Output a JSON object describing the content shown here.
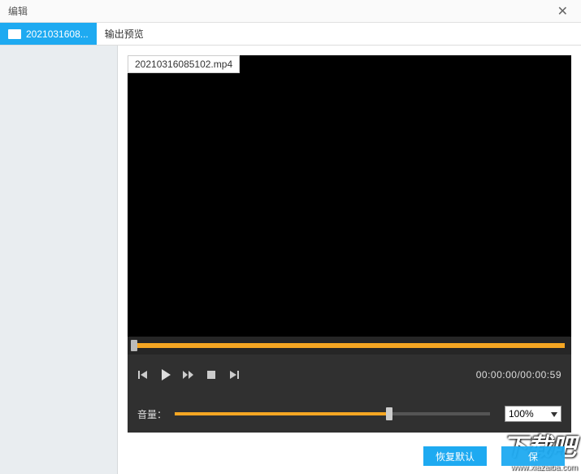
{
  "window": {
    "title": "编辑"
  },
  "tabs": {
    "active_label": "2021031608...",
    "preview_label": "输出预览"
  },
  "file": {
    "name": "20210316085102.mp4"
  },
  "player": {
    "current_time": "00:00:00",
    "duration": "00:00:59",
    "time_display": "00:00:00/00:00:59"
  },
  "volume": {
    "label": "音量：",
    "percent_label": "100%"
  },
  "footer": {
    "restore_default": "恢复默认",
    "save": "保"
  },
  "watermark": {
    "text": "下载吧",
    "url": "www.xiazaiba.com"
  }
}
